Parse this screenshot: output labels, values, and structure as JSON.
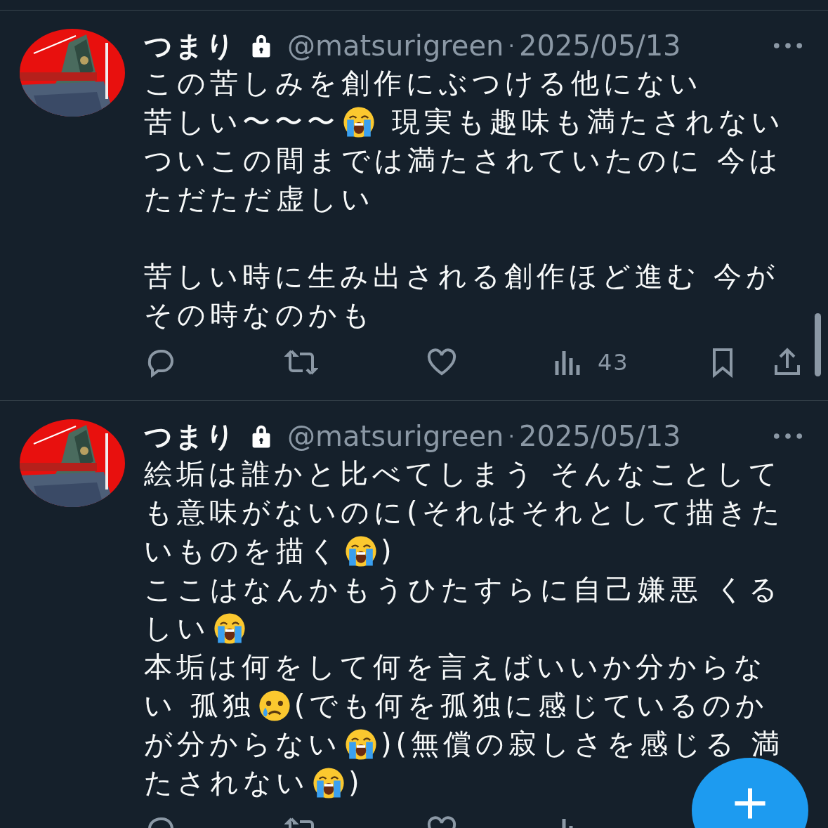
{
  "tweets": [
    {
      "author": {
        "name": "つまり",
        "protected": true,
        "handle": "@matsurigreen",
        "separator": "·",
        "date": "2025/05/13"
      },
      "lines": [
        {
          "kind": "text",
          "parts": [
            {
              "kind": "text",
              "text": "この苦しみを創作にぶつける他にない"
            }
          ]
        },
        {
          "kind": "text",
          "parts": [
            {
              "kind": "text",
              "text": "苦しい〜〜〜"
            },
            {
              "kind": "sob"
            },
            {
              "kind": "text",
              "text": " 現実も趣味も満たされない"
            }
          ]
        },
        {
          "kind": "text",
          "parts": [
            {
              "kind": "text",
              "text": "ついこの間までは満たされていたのに 今は"
            }
          ]
        },
        {
          "kind": "text",
          "parts": [
            {
              "kind": "text",
              "text": "ただただ虚しい"
            }
          ]
        },
        {
          "kind": "blank"
        },
        {
          "kind": "text",
          "parts": [
            {
              "kind": "text",
              "text": "苦しい時に生み出される創作ほど進む 今が"
            }
          ]
        },
        {
          "kind": "text",
          "parts": [
            {
              "kind": "text",
              "text": "その時なのかも"
            }
          ]
        }
      ],
      "stats": {
        "views": "43"
      }
    },
    {
      "author": {
        "name": "つまり",
        "protected": true,
        "handle": "@matsurigreen",
        "separator": "·",
        "date": "2025/05/13"
      },
      "lines": [
        {
          "kind": "text",
          "parts": [
            {
              "kind": "text",
              "text": "絵垢は誰かと比べてしまう そんなことして"
            }
          ]
        },
        {
          "kind": "text",
          "parts": [
            {
              "kind": "text",
              "text": "も意味がないのに(それはそれとして描きた"
            }
          ]
        },
        {
          "kind": "text",
          "parts": [
            {
              "kind": "text",
              "text": "いものを描く"
            },
            {
              "kind": "sob"
            },
            {
              "kind": "text",
              "text": ")"
            }
          ]
        },
        {
          "kind": "text",
          "parts": [
            {
              "kind": "text",
              "text": "ここはなんかもうひたすらに自己嫌悪 くる"
            }
          ]
        },
        {
          "kind": "text",
          "parts": [
            {
              "kind": "text",
              "text": "しい"
            },
            {
              "kind": "sob"
            }
          ]
        },
        {
          "kind": "text",
          "parts": [
            {
              "kind": "text",
              "text": "本垢は何をして何を言えばいいか分からな"
            }
          ]
        },
        {
          "kind": "text",
          "parts": [
            {
              "kind": "text",
              "text": "い 孤独"
            },
            {
              "kind": "sad"
            },
            {
              "kind": "text",
              "text": "(でも何を孤独に感じているのか"
            }
          ]
        },
        {
          "kind": "text",
          "parts": [
            {
              "kind": "text",
              "text": "が分からない"
            },
            {
              "kind": "sob"
            },
            {
              "kind": "text",
              "text": ")(無償の寂しさを感じる 満"
            }
          ]
        },
        {
          "kind": "text",
          "parts": [
            {
              "kind": "text",
              "text": "たされない"
            },
            {
              "kind": "sob"
            },
            {
              "kind": "text",
              "text": ")"
            }
          ]
        }
      ]
    }
  ]
}
